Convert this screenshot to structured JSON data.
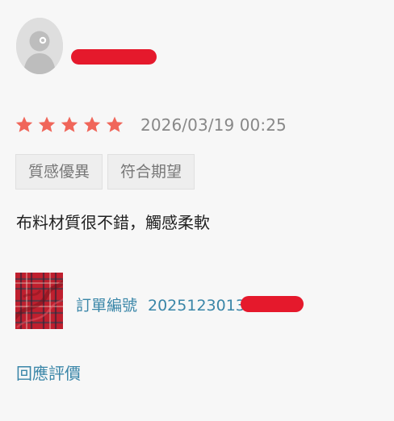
{
  "review": {
    "rating": 5,
    "max_rating": 5,
    "date": "2026/03/19 00:25",
    "tags": [
      {
        "label": "質感優異"
      },
      {
        "label": "符合期望"
      }
    ],
    "text": "布料材質很不錯，觸感柔軟"
  },
  "order": {
    "label": "訂單編號",
    "number_visible": "2025123013"
  },
  "actions": {
    "reply_label": "回應評價"
  },
  "colors": {
    "star": "#f0665a",
    "link": "#3a86a8",
    "redaction": "#e5192c",
    "background": "#f7f7f7"
  },
  "icons": {
    "avatar": "default-user-avatar-icon",
    "star": "star-icon"
  }
}
